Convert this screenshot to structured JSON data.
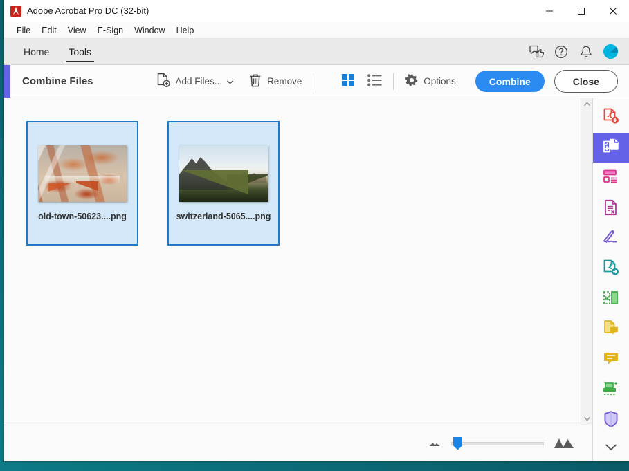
{
  "window": {
    "title": "Adobe Acrobat Pro DC (32-bit)",
    "app_icon": "acrobat-icon",
    "controls": {
      "minimize": "minimize-icon",
      "maximize": "maximize-icon",
      "close": "close-icon"
    }
  },
  "menubar": {
    "items": [
      {
        "label": "File"
      },
      {
        "label": "Edit"
      },
      {
        "label": "View"
      },
      {
        "label": "E-Sign"
      },
      {
        "label": "Window"
      },
      {
        "label": "Help"
      }
    ]
  },
  "tabsbar": {
    "tabs": [
      {
        "label": "Home",
        "active": false
      },
      {
        "label": "Tools",
        "active": true
      }
    ],
    "actions": [
      {
        "icon": "feedback-icon"
      },
      {
        "icon": "help-icon"
      },
      {
        "icon": "bell-icon"
      },
      {
        "icon": "avatar"
      }
    ]
  },
  "toolbar": {
    "title": "Combine Files",
    "add_files_label": "Add Files...",
    "remove_label": "Remove",
    "options_label": "Options",
    "combine_label": "Combine",
    "close_label": "Close",
    "view_grid": "grid-view-icon",
    "view_list": "list-view-icon",
    "accent_color": "#6562e8",
    "primary_color": "#2a8bf2"
  },
  "files": [
    {
      "name": "old-town-50623....png",
      "selected": true,
      "art": "old-town"
    },
    {
      "name": "switzerland-5065....png",
      "selected": true,
      "art": "switzerland"
    }
  ],
  "zoombar": {
    "small_icon": "small-thumbnail-icon",
    "large_icon": "large-thumbnail-icon",
    "slider_position": "3"
  },
  "rail": {
    "items": [
      {
        "name": "create-pdf",
        "color": "#e8453c",
        "active": false
      },
      {
        "name": "combine-files",
        "color": "#ffffff",
        "active": true
      },
      {
        "name": "organize-pages",
        "color": "#e0318f",
        "active": false
      },
      {
        "name": "export-pdf",
        "color": "#b5379a",
        "active": false
      },
      {
        "name": "fill-and-sign",
        "color": "#7b5cd6",
        "active": false
      },
      {
        "name": "send-for-signature",
        "color": "#1a9aa0",
        "active": false
      },
      {
        "name": "compare-files",
        "color": "#3fae49",
        "active": false
      },
      {
        "name": "comment-document",
        "color": "#e0b520",
        "active": false
      },
      {
        "name": "add-comment",
        "color": "#e0b520",
        "active": false
      },
      {
        "name": "scan-and-ocr",
        "color": "#3fae49",
        "active": false
      },
      {
        "name": "protect",
        "color": "#7b5cd6",
        "active": false
      }
    ],
    "more_icon": "chevron-down-icon"
  },
  "scrollbar": {
    "up_icon": "scroll-up-icon",
    "down_icon": "scroll-down-icon"
  }
}
